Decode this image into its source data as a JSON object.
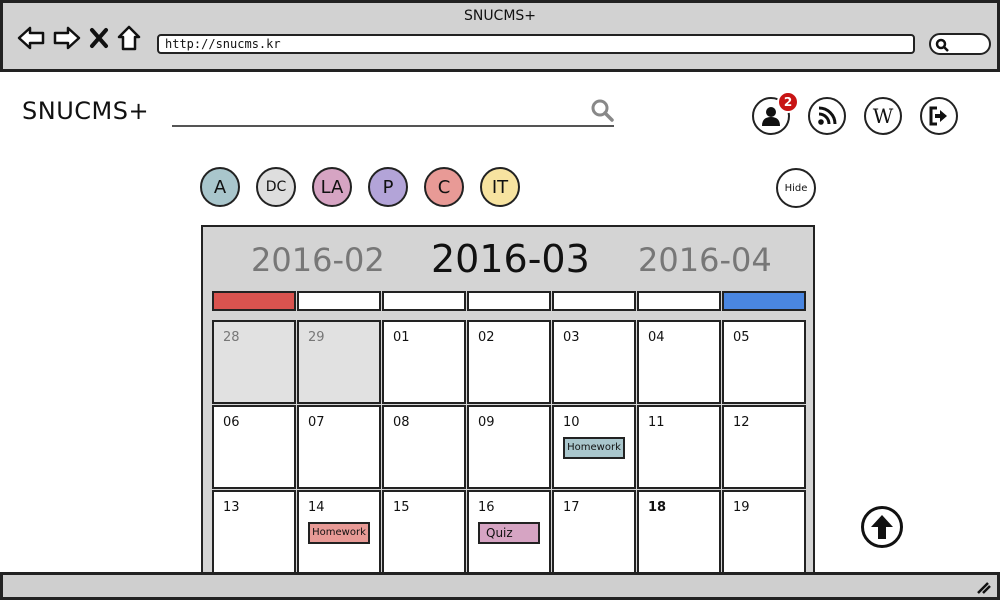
{
  "browser": {
    "title": "SNUCMS+",
    "url": "http://snucms.kr",
    "nav_icons": [
      "back-arrow-icon",
      "forward-arrow-icon",
      "close-icon",
      "home-icon"
    ]
  },
  "header": {
    "brand": "SNUCMS+",
    "search_placeholder": "",
    "notification_count": "2",
    "wiki_label": "W",
    "icons": [
      "user-icon",
      "rss-icon",
      "wikipedia-icon",
      "logout-icon"
    ]
  },
  "courses": [
    {
      "label": "A",
      "color": "#a9c6cc"
    },
    {
      "label": "DC",
      "color": "#dedede"
    },
    {
      "label": "LA",
      "color": "#d6a4c3"
    },
    {
      "label": "P",
      "color": "#b3a4d8"
    },
    {
      "label": "C",
      "color": "#e89a96"
    },
    {
      "label": "IT",
      "color": "#f7e3a0"
    }
  ],
  "hide_label": "Hide",
  "calendar": {
    "prev_month": "2016-02",
    "current_month": "2016-03",
    "next_month": "2016-04",
    "weekday_colors": [
      "#d9534f",
      "#ffffff",
      "#ffffff",
      "#ffffff",
      "#ffffff",
      "#ffffff",
      "#4a86e0"
    ],
    "weeks": [
      [
        {
          "d": "28",
          "other": true
        },
        {
          "d": "29",
          "other": true
        },
        {
          "d": "01"
        },
        {
          "d": "02"
        },
        {
          "d": "03"
        },
        {
          "d": "04"
        },
        {
          "d": "05"
        }
      ],
      [
        {
          "d": "06"
        },
        {
          "d": "07"
        },
        {
          "d": "08"
        },
        {
          "d": "09"
        },
        {
          "d": "10",
          "event": {
            "label": "Homework",
            "color": "#a9c6cc"
          }
        },
        {
          "d": "11"
        },
        {
          "d": "12"
        }
      ],
      [
        {
          "d": "13"
        },
        {
          "d": "14",
          "event": {
            "label": "Homework",
            "color": "#e89a96"
          }
        },
        {
          "d": "15"
        },
        {
          "d": "16",
          "event": {
            "label": "Quiz",
            "color": "#d6a4c3"
          }
        },
        {
          "d": "17"
        },
        {
          "d": "18",
          "bold": true
        },
        {
          "d": "19"
        }
      ]
    ]
  }
}
